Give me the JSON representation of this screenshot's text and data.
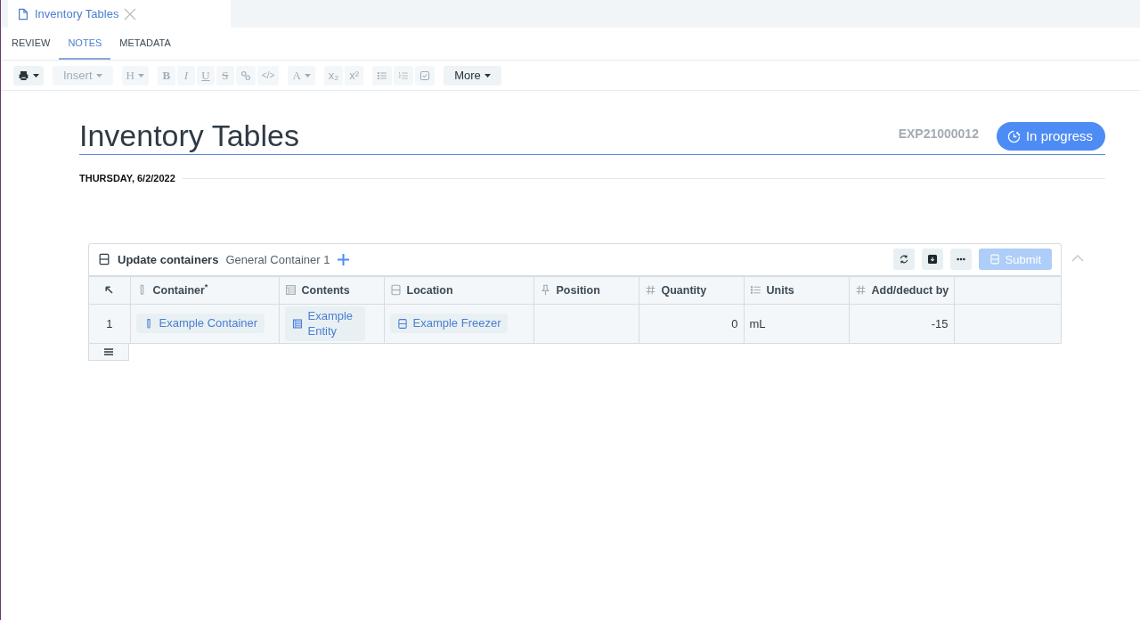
{
  "doc_tab": {
    "title": "Inventory Tables"
  },
  "nav_tabs": [
    {
      "label": "REVIEW",
      "selected": false
    },
    {
      "label": "NOTES",
      "selected": true
    },
    {
      "label": "METADATA",
      "selected": false
    }
  ],
  "toolbar": [
    {
      "kind": "print",
      "disabled": false
    },
    {
      "kind": "insert",
      "label": "Insert",
      "disabled": true
    },
    {
      "kind": "heading",
      "label": "H",
      "disabled": true
    },
    {
      "kind": "bold",
      "label": "B",
      "disabled": true
    },
    {
      "kind": "italic",
      "label": "I",
      "disabled": true
    },
    {
      "kind": "underline",
      "label": "U",
      "disabled": true
    },
    {
      "kind": "strike",
      "label": "S",
      "disabled": true
    },
    {
      "kind": "link",
      "disabled": true
    },
    {
      "kind": "code",
      "label": "</>",
      "disabled": true
    },
    {
      "kind": "color",
      "label": "A",
      "disabled": true
    },
    {
      "kind": "subscript",
      "label": "x₂",
      "disabled": true
    },
    {
      "kind": "superscript",
      "label": "x²",
      "disabled": true
    },
    {
      "kind": "bullets",
      "disabled": true
    },
    {
      "kind": "numbers",
      "disabled": true
    },
    {
      "kind": "check",
      "disabled": true
    },
    {
      "kind": "more",
      "label": "More",
      "disabled": false
    }
  ],
  "entry": {
    "title": "Inventory Tables",
    "id": "EXP21000012",
    "status": "In progress",
    "date": "THURSDAY, 6/2/2022"
  },
  "table": {
    "title": "Update containers",
    "subtitle": "General Container 1",
    "submit": "Submit",
    "submit_disabled": true,
    "columns": [
      {
        "kind": "container",
        "label": "Container$^{*}$"
      },
      {
        "kind": "entity",
        "label": "Contents"
      },
      {
        "kind": "location",
        "label": "Location"
      },
      {
        "kind": "position",
        "label": "Position"
      },
      {
        "kind": "number",
        "label": "Quantity"
      },
      {
        "kind": "list",
        "label": "Units"
      },
      {
        "kind": "number",
        "label": "Add/deduct by"
      }
    ],
    "rows": [
      {
        "number": "1",
        "cells": [
          {
            "kind": "chip",
            "text": "Example Container"
          },
          {
            "kind": "chip",
            "text": "Example Entity"
          },
          {
            "kind": "chip",
            "text": "Example Freezer"
          },
          {
            "kind": "empty"
          },
          {
            "kind": "number",
            "text": "0"
          },
          {
            "kind": "text",
            "text": "mL"
          },
          {
            "kind": "number",
            "text": "-15"
          }
        ]
      }
    ]
  }
}
